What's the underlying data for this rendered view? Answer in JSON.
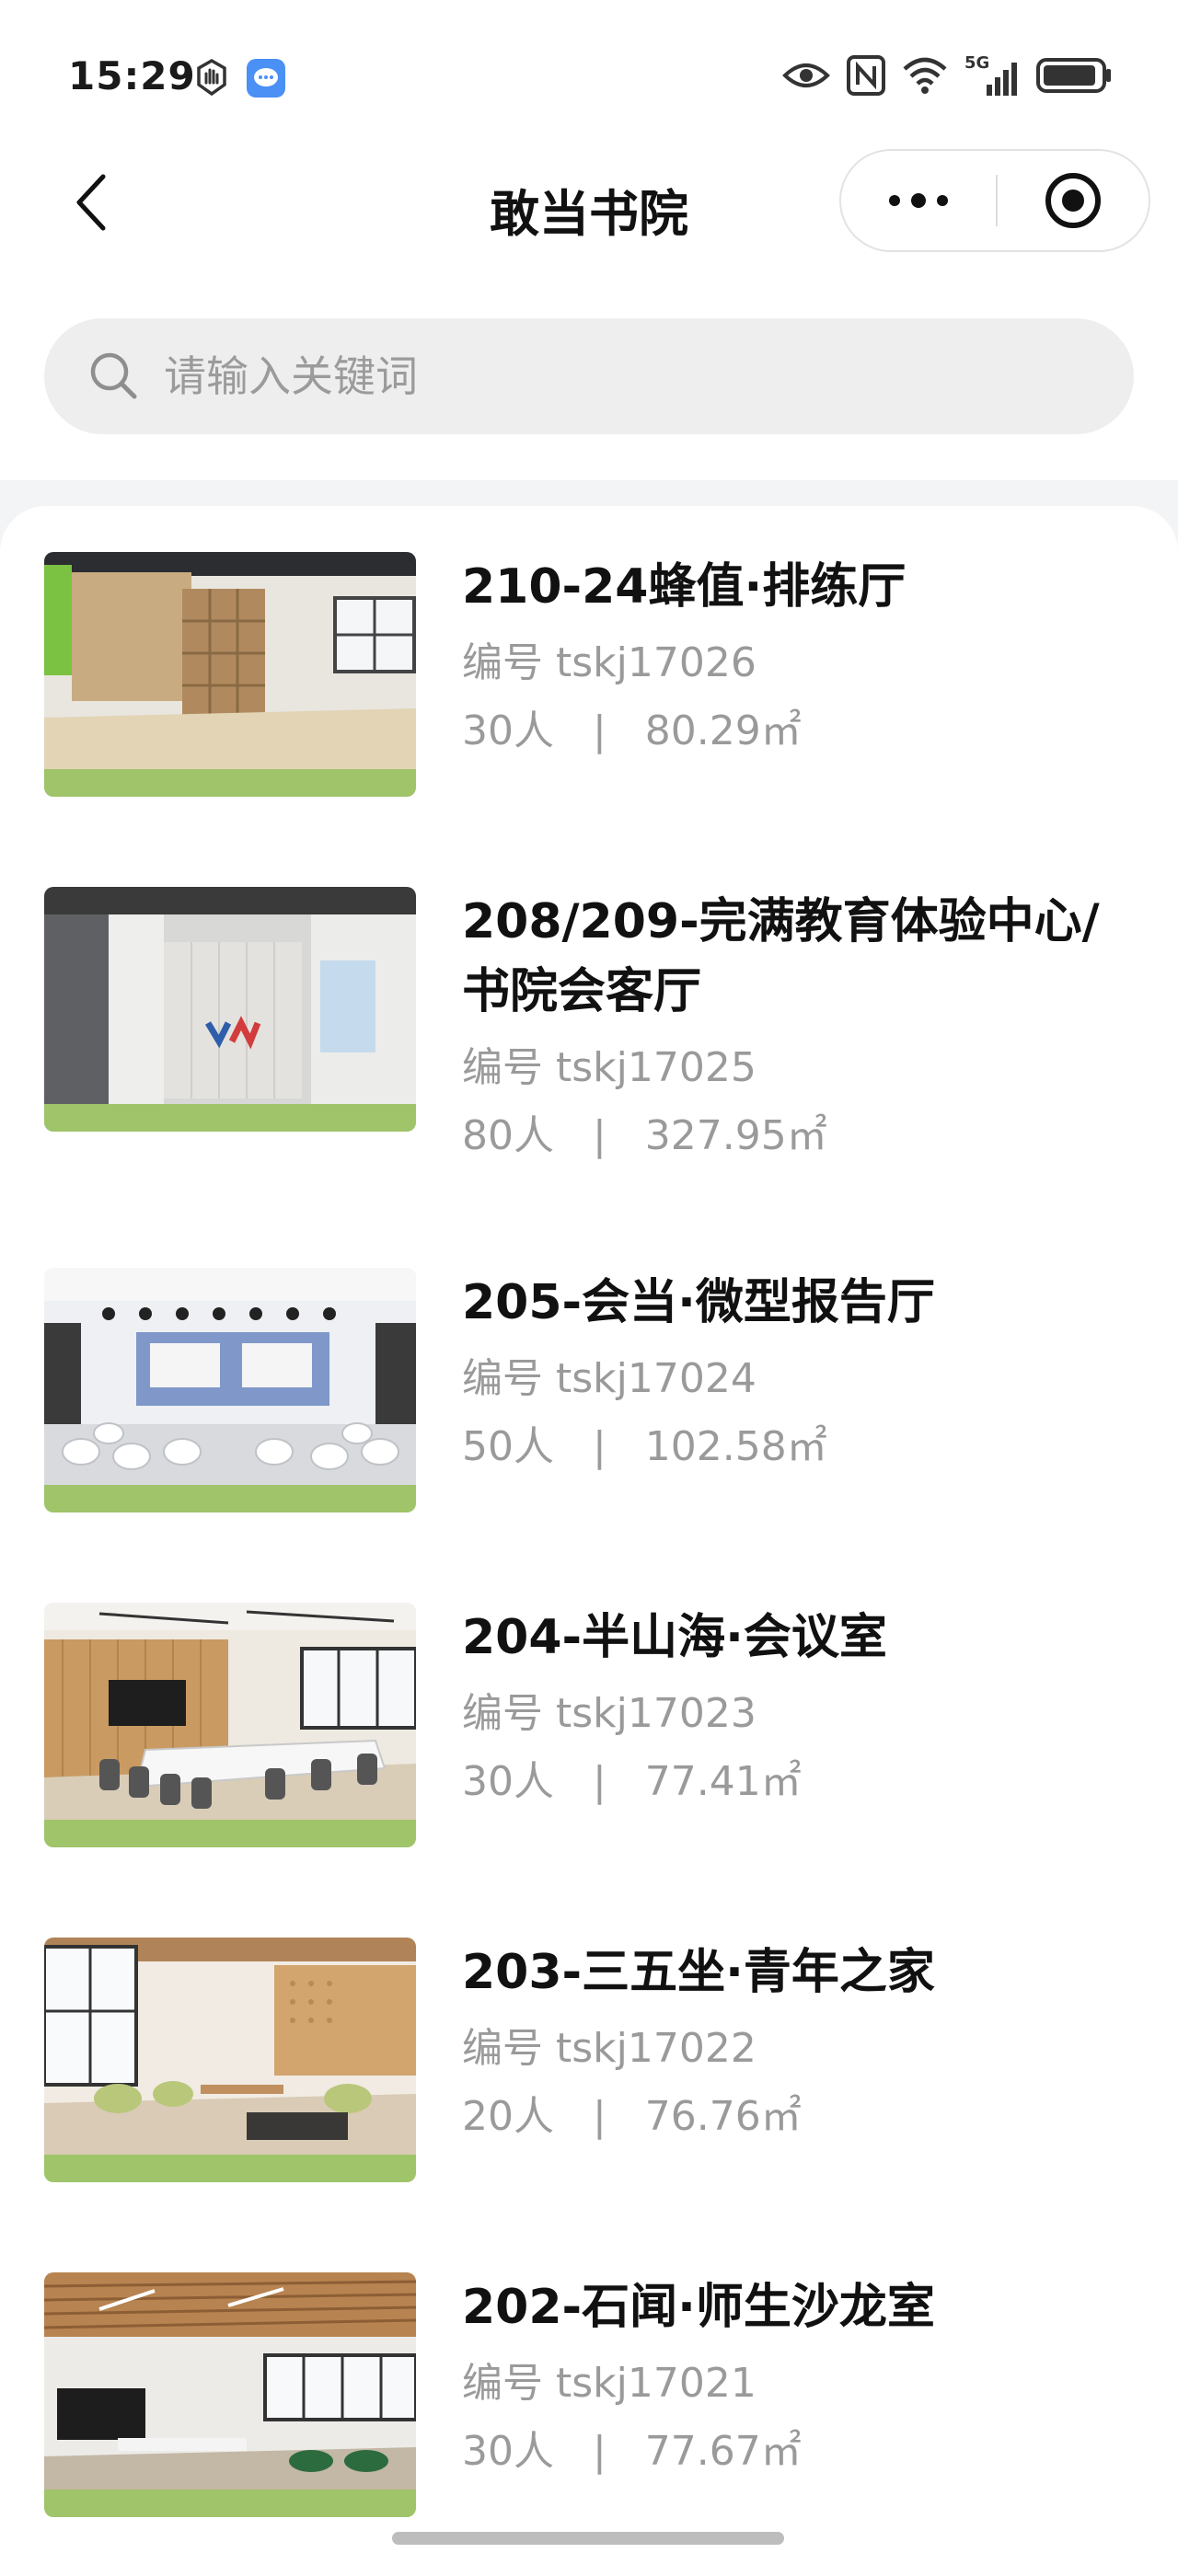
{
  "status_bar": {
    "time": "15:29",
    "left_icons": [
      "gesture-icon",
      "message-app-icon"
    ],
    "right_icons": [
      "eye-icon",
      "nfc-icon",
      "wifi-icon",
      "5g-signal-icon",
      "battery-icon"
    ],
    "network_label": "5G"
  },
  "nav": {
    "title": "敢当书院",
    "back_icon": "chevron-left-icon",
    "more_icon": "more-dots-icon",
    "close_icon": "target-close-icon"
  },
  "search": {
    "placeholder": "请输入关键词",
    "value": ""
  },
  "rooms": [
    {
      "title": "210-24蜂值·排练厅",
      "code": "编号 tskj17026",
      "capacity": "30人",
      "area": "80.29㎡",
      "thumb": "rehearsal-hall-photo"
    },
    {
      "title": "208/209-完满教育体验中心/书院会客厅",
      "code": "编号 tskj17025",
      "capacity": "80人",
      "area": "327.95㎡",
      "thumb": "experience-center-photo"
    },
    {
      "title": "205-会当·微型报告厅",
      "code": "编号 tskj17024",
      "capacity": "50人",
      "area": "102.58㎡",
      "thumb": "lecture-hall-photo"
    },
    {
      "title": "204-半山海·会议室",
      "code": "编号 tskj17023",
      "capacity": "30人",
      "area": "77.41㎡",
      "thumb": "meeting-room-photo"
    },
    {
      "title": "203-三五坐·青年之家",
      "code": "编号 tskj17022",
      "capacity": "20人",
      "area": "76.76㎡",
      "thumb": "youth-home-photo"
    },
    {
      "title": "202-石闻·师生沙龙室",
      "code": "编号 tskj17021",
      "capacity": "30人",
      "area": "77.67㎡",
      "thumb": "salon-room-photo"
    }
  ],
  "meta_separator": "|",
  "colors": {
    "title": "#111111",
    "secondary": "#9a9a9a",
    "search_bg": "#eeeeee",
    "thumb_banner": "#9fc46a"
  }
}
